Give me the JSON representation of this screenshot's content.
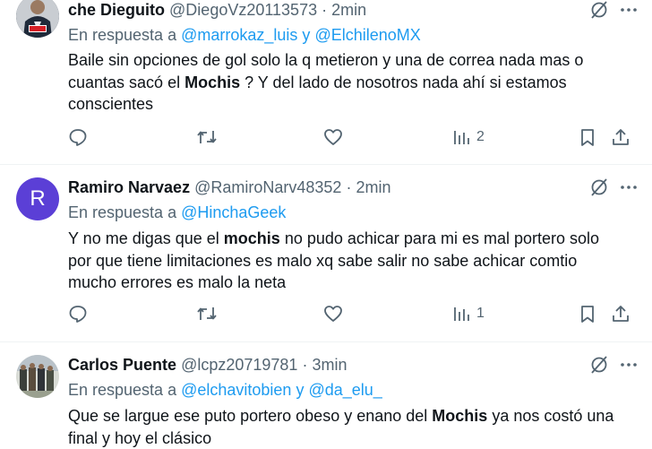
{
  "tweets": [
    {
      "name": "che Dieguito",
      "handle": "@DiegoVz20113573",
      "time": "2min",
      "reply_prefix": "En respuesta a",
      "mentions": [
        "@marrokaz_luis",
        "@ElchilenoMX"
      ],
      "mention_joiner": "y",
      "body_parts": [
        "Baile sin opciones de gol  solo la q metieron y una de correa nada mas o cuantas sacó el ",
        "Mochis",
        " ? Y del lado de nosotros nada ahí si estamos conscientes"
      ],
      "views": "2",
      "avatar_badge": "BIMBO"
    },
    {
      "name": "Ramiro Narvaez",
      "handle": "@RamiroNarv48352",
      "time": "2min",
      "reply_prefix": "En respuesta a",
      "mentions": [
        "@HinchaGeek"
      ],
      "mention_joiner": "",
      "body_parts": [
        "Y no me digas que el ",
        "mochis",
        " no pudo achicar para mi es mal portero solo por que tiene limitaciones es malo xq sabe salir no sabe achicar comtio mucho errores es malo la neta"
      ],
      "views": "1",
      "avatar_letter": "R",
      "avatar_color": "#5b3fd6"
    },
    {
      "name": "Carlos Puente",
      "handle": "@lcpz20719781",
      "time": "3min",
      "reply_prefix": "En respuesta a",
      "mentions": [
        "@elchavitobien",
        "@da_elu_"
      ],
      "mention_joiner": "y",
      "body_parts": [
        "Que se largue ese puto portero obeso y enano  del ",
        "Mochis",
        "  ya nos costó una final y hoy el clásico"
      ],
      "views": ""
    }
  ],
  "icons": {
    "more": "more-icon",
    "grok": "grok-icon",
    "reply": "reply-icon",
    "retweet": "retweet-icon",
    "like": "like-icon",
    "views": "views-icon",
    "bookmark": "bookmark-icon",
    "share": "share-icon"
  },
  "colors": {
    "link": "#1d9bf0",
    "muted": "#536471",
    "text": "#0f1419"
  }
}
